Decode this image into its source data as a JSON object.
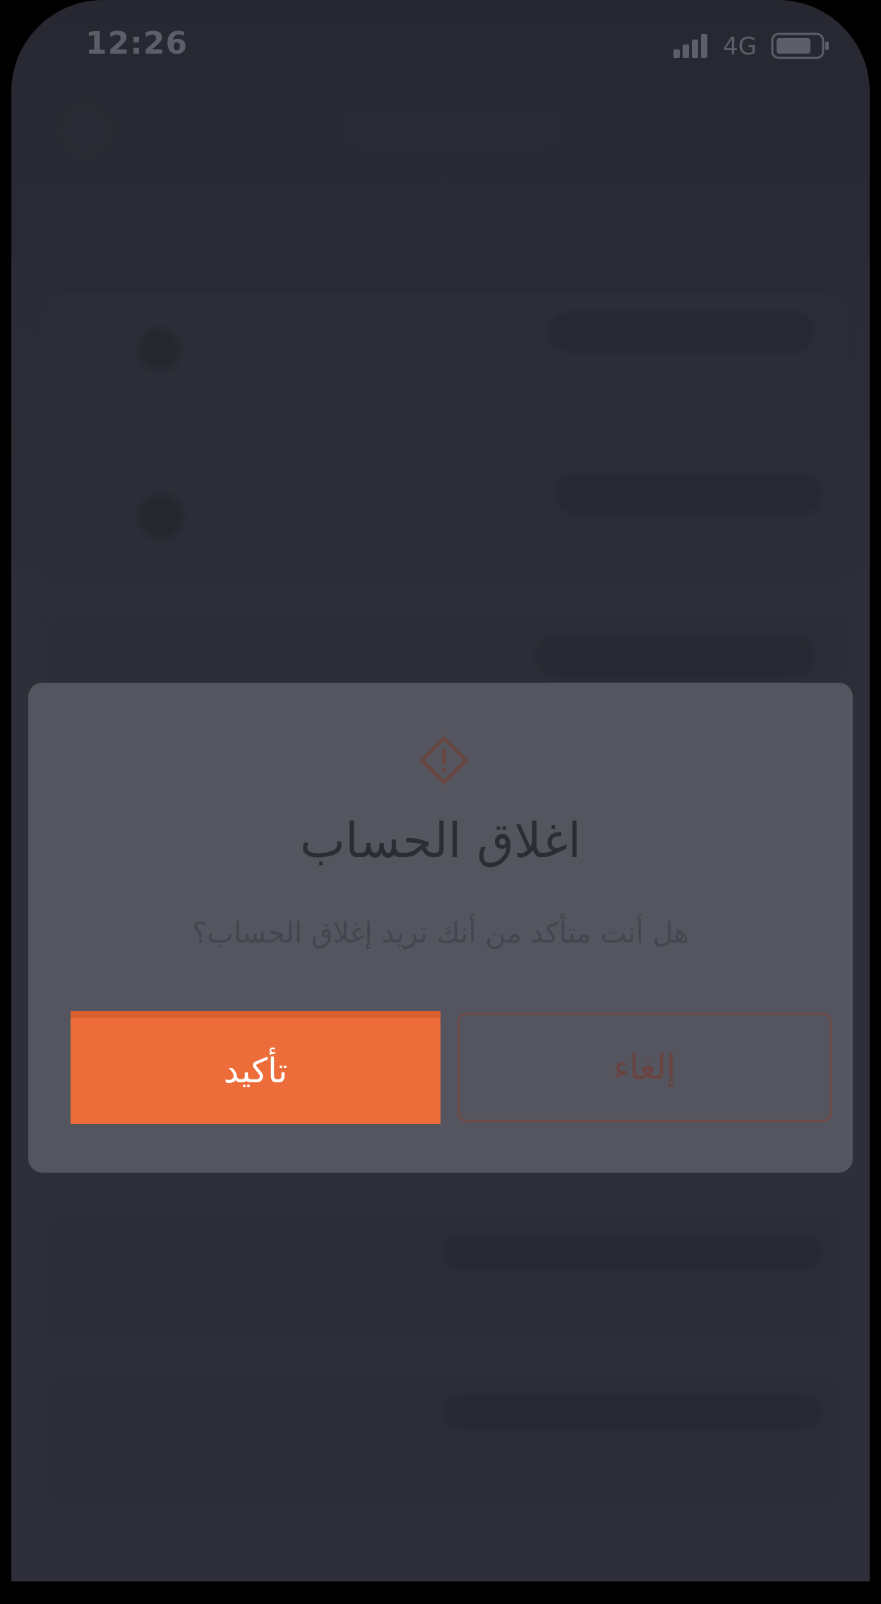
{
  "status_bar": {
    "time": "12:26",
    "network": "4G",
    "signal_icon": "signal-bars-icon",
    "battery_icon": "battery-icon"
  },
  "dialog": {
    "icon": "warning-diamond-icon",
    "title": "اغلاق الحساب",
    "message": "هل أنت متأكد من أنك تريد إغلاق الحساب؟",
    "confirm_label": "تأكيد",
    "cancel_label": "إلغاء"
  },
  "colors": {
    "accent": "#ec6d39",
    "dialog_background": "#55555f",
    "screen_background": "#353540",
    "cancel_border": "#6e4a46"
  }
}
